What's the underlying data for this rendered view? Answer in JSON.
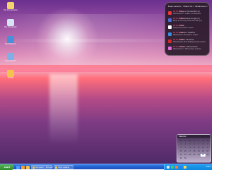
{
  "desktop": {
    "icons": [
      {
        "label": "My Documents",
        "color": "#f3d36b"
      },
      {
        "label": "My Computer",
        "color": "#d7e4f3"
      },
      {
        "label": "My Network",
        "color": "#4a90d9"
      },
      {
        "label": "Recycle Bin",
        "color": "#7db0e6"
      },
      {
        "label": "Folder",
        "color": "#f3c34b"
      }
    ]
  },
  "notifications": {
    "title": "Ещё записи · Новости с облачных сервисов",
    "items": [
      {
        "icon_color": "#e83a3a",
        "time": "08:45 27.09",
        "text": "Вход на Yandex.Mail (2)",
        "sub": "Обновлено 2 новых сообщения"
      },
      {
        "icon_color": "#4a6fd6",
        "time": "08:45 27.09",
        "text": "Обновление Google (2)",
        "sub": "Вход в систему Calendar Wiki (2)"
      },
      {
        "icon_color": "#ffffff",
        "time": "08:45 27.09",
        "text": "Gmail",
        "sub": "Новые письма из Inbox"
      },
      {
        "icon_color": "#3b8de0",
        "time": "08:45 27.09",
        "text": "Calendar: Weather",
        "sub": "Обновлено сегодня 2 новых"
      },
      {
        "icon_color": "#d12a2a",
        "time": "08:45 27.09",
        "text": "Twitter: Facebook",
        "sub": "Обновлены (24) Реферальная акция"
      },
      {
        "icon_color": "#e06dd8",
        "time": "08:45 27.09",
        "text": "Yandex: Обновления",
        "sub": "Обновлено 2 (80) новых записи"
      }
    ]
  },
  "calendar": {
    "title": "Calendar",
    "days": [
      "Mo",
      "Tu",
      "We",
      "Th",
      "Fr",
      "Sa",
      "Su",
      "1",
      "2",
      "3",
      "4",
      "5",
      "6",
      "7",
      "8",
      "9",
      "10",
      "11",
      "12",
      "13",
      "14",
      "15",
      "16",
      "17",
      "18",
      "19",
      "20",
      "21",
      "22",
      "23",
      "24",
      "25",
      "26",
      "27",
      "28",
      "29",
      "30"
    ],
    "today": "27"
  },
  "taskbar": {
    "start_label": "start",
    "quick_launch": [
      {
        "name": "browser-icon",
        "color": "#4aa3ff"
      },
      {
        "name": "media-icon",
        "color": "#ff9d2e"
      },
      {
        "name": "folder-icon",
        "color": "#f3c34b"
      }
    ],
    "tasks": [
      {
        "label": "Документ - Блокнот"
      },
      {
        "label": "Окно задачи"
      }
    ],
    "tray_icons": [
      "#e8e8e8",
      "#4ad24a",
      "#ff7b2e",
      "#2e7bff",
      "#ffd84a"
    ],
    "clock": "8:45"
  }
}
